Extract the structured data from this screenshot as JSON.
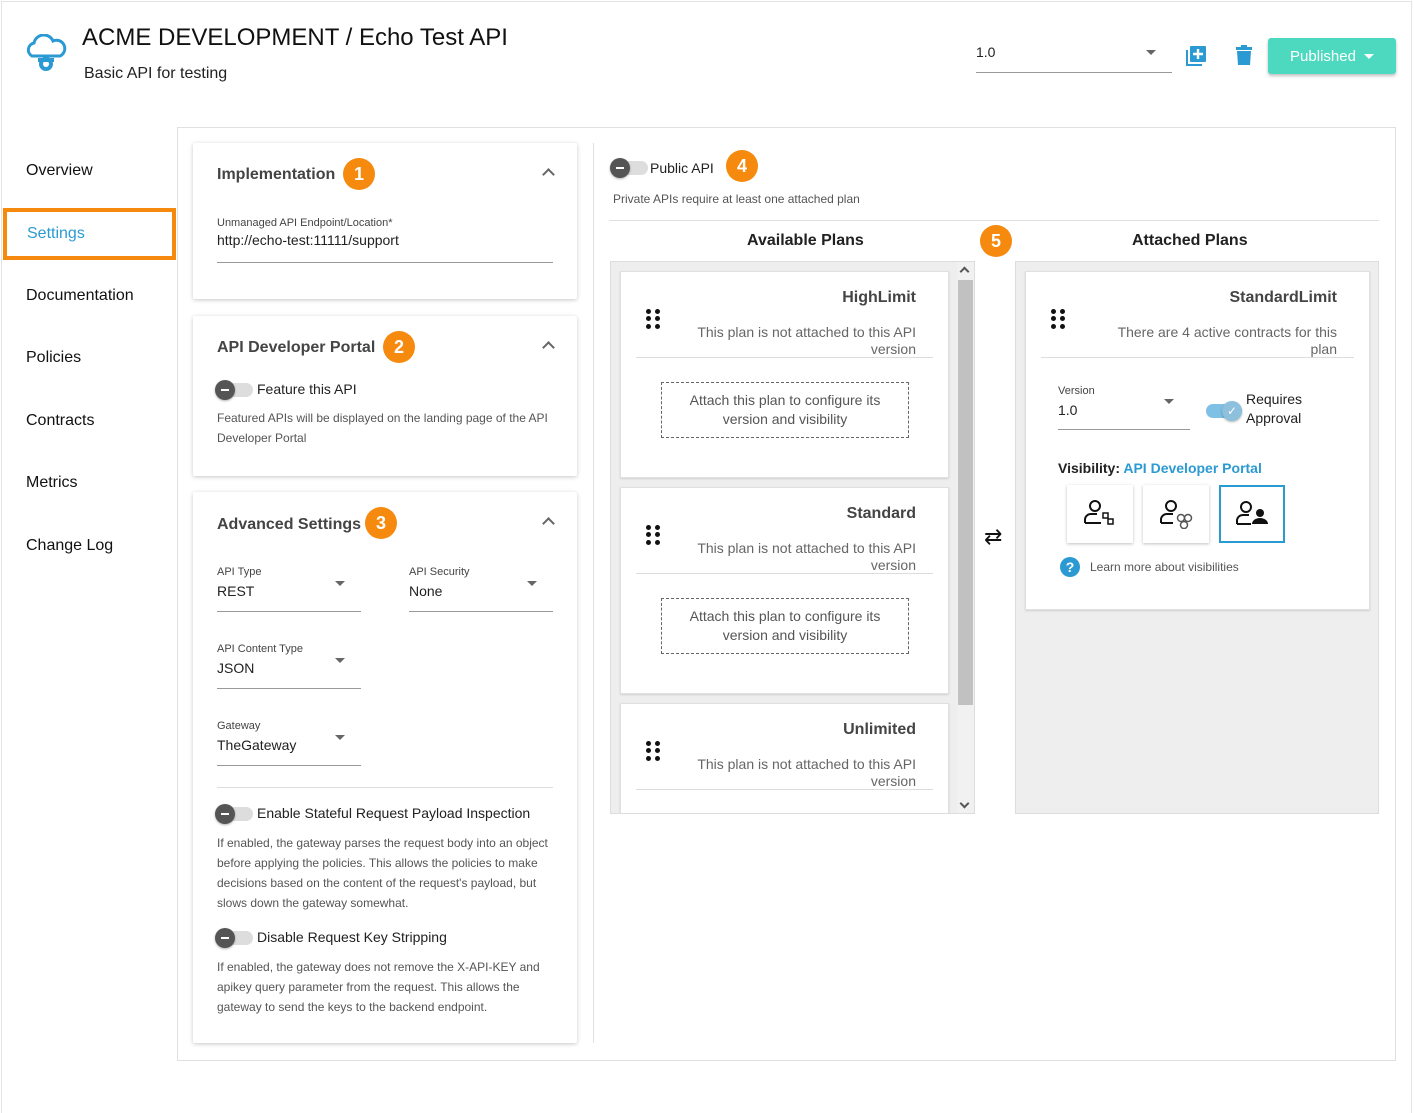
{
  "header": {
    "title": "ACME DEVELOPMENT / Echo Test API",
    "subtitle": "Basic API for testing",
    "version": "1.0",
    "status_button": "Published",
    "icons": [
      "cloud-gear-logo",
      "add-version-icon",
      "delete-icon"
    ]
  },
  "sidebar": {
    "items": [
      {
        "label": "Overview"
      },
      {
        "label": "Settings",
        "selected": true
      },
      {
        "label": "Documentation"
      },
      {
        "label": "Policies"
      },
      {
        "label": "Contracts"
      },
      {
        "label": "Metrics"
      },
      {
        "label": "Change Log"
      }
    ]
  },
  "implementation": {
    "title": "Implementation",
    "badge": "1",
    "endpoint_label": "Unmanaged API Endpoint/Location*",
    "endpoint_value": "http://echo-test:11111/support"
  },
  "portal": {
    "title": "API Developer Portal",
    "badge": "2",
    "feature_label": "Feature this API",
    "feature_help": "Featured APIs will be displayed on the landing page of the API Developer Portal"
  },
  "advanced": {
    "title": "Advanced Settings",
    "badge": "3",
    "api_type_label": "API Type",
    "api_type": "REST",
    "security_label": "API Security",
    "security": "None",
    "content_type_label": "API Content Type",
    "content_type": "JSON",
    "gateway_label": "Gateway",
    "gateway": "TheGateway",
    "stateful_label": "Enable Stateful Request Payload Inspection",
    "stateful_help": "If enabled, the gateway parses the request body into an object before applying the policies. This allows the policies to make decisions based on the content of the request's payload, but slows down the gateway somewhat.",
    "stripping_label": "Disable Request Key Stripping",
    "stripping_help": "If enabled, the gateway does not remove the X-API-KEY and apikey query parameter from the request. This allows the gateway to send the keys to the backend endpoint."
  },
  "public": {
    "label": "Public API",
    "badge": "4",
    "help": "Private APIs require at least one attached plan"
  },
  "plans": {
    "available_title": "Available Plans",
    "attached_title": "Attached Plans",
    "badge": "5",
    "available": [
      {
        "name": "HighLimit",
        "desc": "This plan is not attached to this API version",
        "attach": "Attach this plan to configure its version and visibility"
      },
      {
        "name": "Standard",
        "desc": "This plan is not attached to this API version",
        "attach": "Attach this plan to configure its version and visibility"
      },
      {
        "name": "Unlimited",
        "desc": "This plan is not attached to this API version"
      }
    ],
    "attached": {
      "name": "StandardLimit",
      "desc": "There are 4 active contracts for this plan",
      "version_label": "Version",
      "version": "1.0",
      "approval_label": "Requires Approval",
      "requires_approval": true,
      "visibility_label": "Visibility:",
      "visibility_value": "API Developer Portal",
      "learn_more": "Learn more about visibilities"
    }
  },
  "colors": {
    "accent": "#2b9ad3",
    "badge": "#f58a0e",
    "published": "#4dd9bf"
  }
}
